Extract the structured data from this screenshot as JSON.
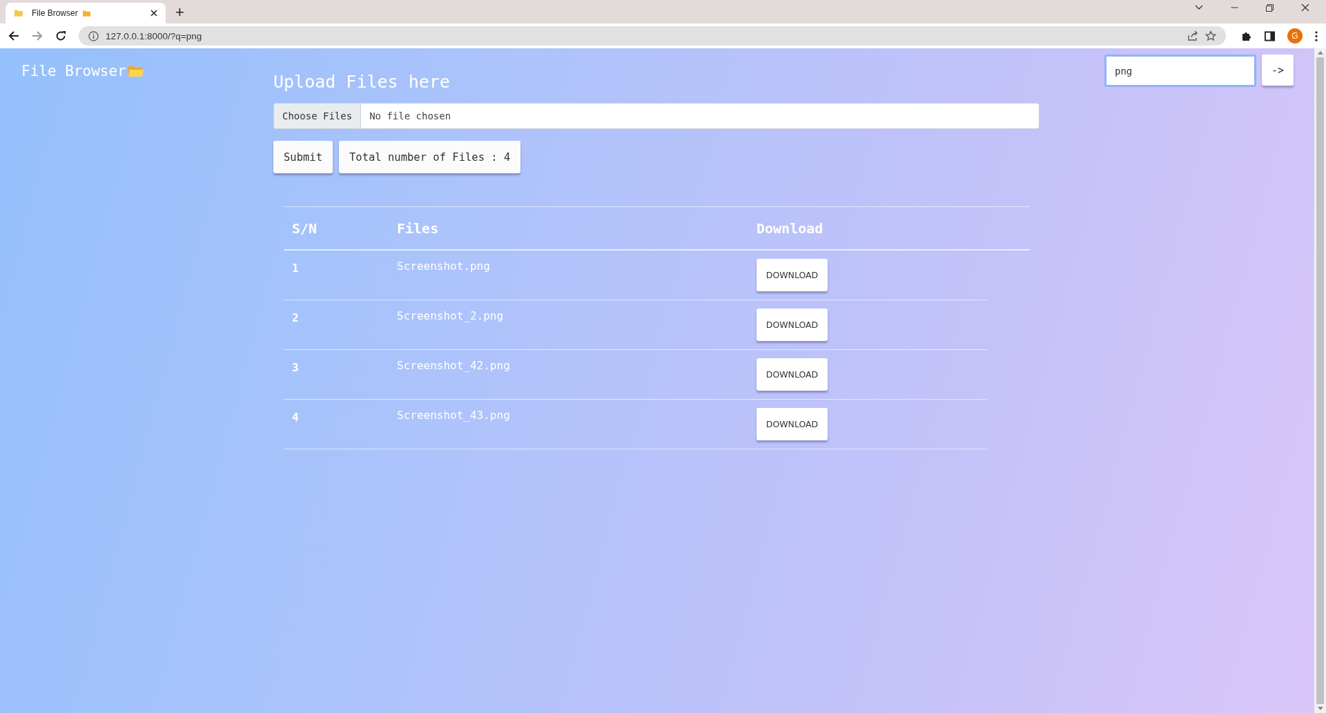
{
  "browser": {
    "tab_title": "File Browser",
    "new_tab": "+",
    "url": "127.0.0.1:8000/?q=png",
    "avatar_letter": "G"
  },
  "header": {
    "title": "File Browser",
    "search": {
      "value": "png"
    },
    "search_button": "->"
  },
  "upload": {
    "heading": "Upload Files here",
    "choose_button": "Choose Files",
    "file_status": "No file chosen",
    "submit": "Submit",
    "total": "Total number of Files : 4"
  },
  "table": {
    "columns": [
      "S/N",
      "Files",
      "Download"
    ],
    "rows": [
      {
        "sn": "1",
        "file": "Screenshot.png",
        "action": "DOWNLOAD"
      },
      {
        "sn": "2",
        "file": "Screenshot_2.png",
        "action": "DOWNLOAD"
      },
      {
        "sn": "3",
        "file": "Screenshot_42.png",
        "action": "DOWNLOAD"
      },
      {
        "sn": "4",
        "file": "Screenshot_43.png",
        "action": "DOWNLOAD"
      }
    ]
  }
}
